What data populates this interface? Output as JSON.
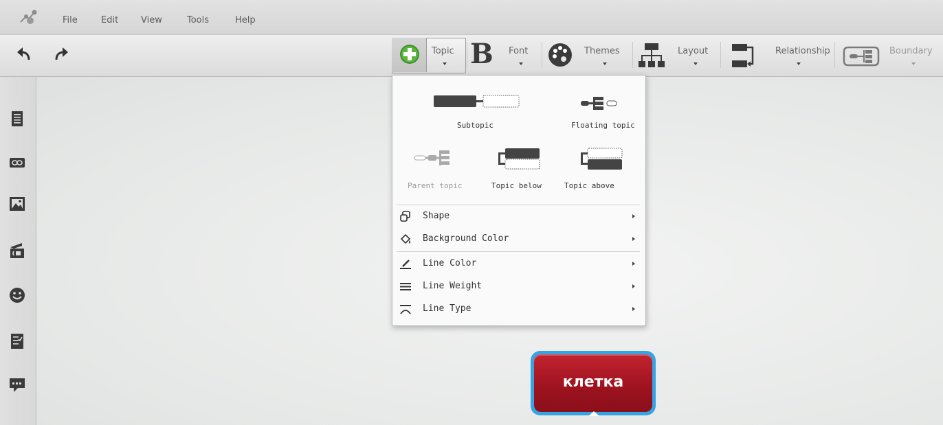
{
  "menubar": {
    "items": [
      "File",
      "Edit",
      "View",
      "Tools",
      "Help"
    ]
  },
  "toolbar": {
    "undo_icon": "undo-icon",
    "redo_icon": "redo-icon",
    "topic": "Topic",
    "font": "Font",
    "font_icon_glyph": "B",
    "themes": "Themes",
    "layout": "Layout",
    "relationship": "Relationship",
    "boundary": "Boundary"
  },
  "sidebar": {
    "icons": [
      "notes-icon",
      "link-icon",
      "image-icon",
      "audio-note-icon",
      "emoji-icon",
      "task-icon",
      "comments-icon"
    ]
  },
  "topic_menu": {
    "tiles": {
      "subtopic": "Subtopic",
      "floating_topic": "Floating topic",
      "parent_topic": "Parent topic",
      "topic_below": "Topic below",
      "topic_above": "Topic above"
    },
    "parent_topic_disabled": true,
    "items": {
      "shape": "Shape",
      "background_color": "Background Color",
      "line_color": "Line Color",
      "line_weight": "Line Weight",
      "line_type": "Line Type"
    }
  },
  "node": {
    "text": "клетка",
    "fill_color": "#a8151f",
    "border_color": "#36a3e3"
  }
}
